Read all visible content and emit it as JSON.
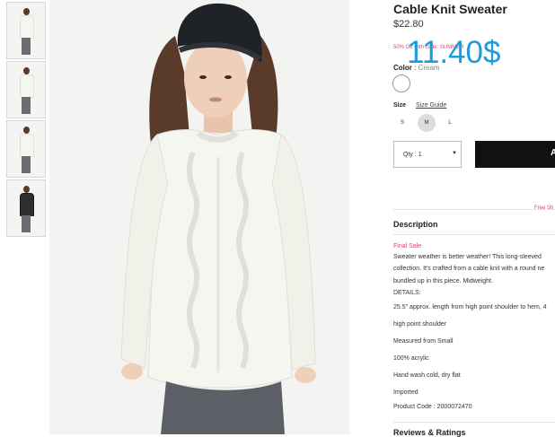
{
  "thumbnails": [
    {
      "alt": "front"
    },
    {
      "alt": "side"
    },
    {
      "alt": "back"
    },
    {
      "alt": "jacket"
    }
  ],
  "product": {
    "title": "Cable Knit Sweater",
    "price": "$22.80",
    "promo": "50% Off with code: SUMMER",
    "overlay_price": "11.40$",
    "color_label": "Color",
    "color_value": "Cream",
    "size_label": "Size",
    "size_guide": "Size Guide",
    "sizes": [
      {
        "label": "S",
        "selected": false
      },
      {
        "label": "M",
        "selected": true
      },
      {
        "label": "L",
        "selected": false
      }
    ],
    "qty_label": "Qty : 1",
    "add_button": "A",
    "free_shipping": "Free Sh"
  },
  "description": {
    "title": "Description",
    "final_sale": "Final Sale",
    "lines": [
      "Sweater weather is better weather! This long-sleeved",
      "collection. It's crafted from a cable knit with a round ne",
      "bundled up in this piece. Midweight.",
      "DETAILS:",
      "25.5\" approx. length from high point shoulder to hem, 4",
      "high point shoulder",
      "Measured from Small",
      "100% acrylic",
      "Hand wash cold, dry flat",
      "Imported",
      "Product Code : 2000072470"
    ]
  },
  "reviews_title": "Reviews & Ratings",
  "colors": {
    "accent_pink": "#e0407a",
    "overlay_blue": "#1c9be0",
    "button_black": "#111111",
    "sweater": "#f6f6f1",
    "hat": "#1f2226",
    "hair": "#5a3a28",
    "jeans": "#5c5f66"
  }
}
